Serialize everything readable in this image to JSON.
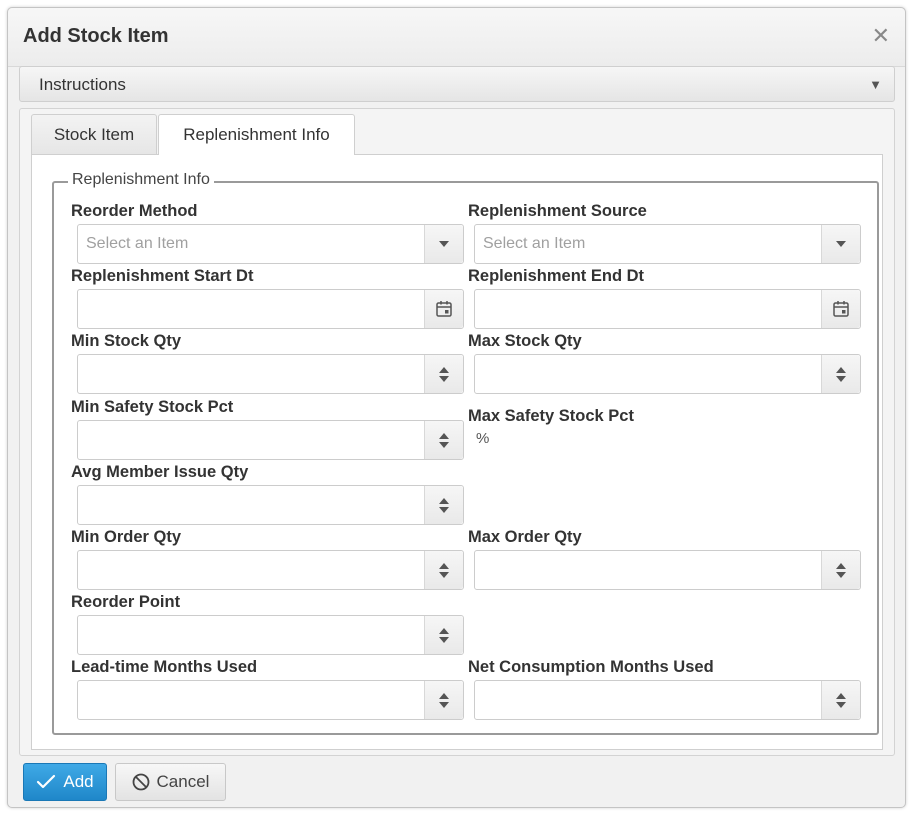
{
  "dialog": {
    "title": "Add Stock Item",
    "close_icon": "close-icon"
  },
  "instructions": {
    "label": "Instructions"
  },
  "tabs": [
    {
      "label": "Stock Item",
      "active": false
    },
    {
      "label": "Replenishment Info",
      "active": true
    }
  ],
  "section": {
    "legend": "Replenishment Info"
  },
  "fields": {
    "reorder_method": {
      "label": "Reorder Method",
      "placeholder": "Select an Item"
    },
    "replenishment_source": {
      "label": "Replenishment Source",
      "placeholder": "Select an Item"
    },
    "replenishment_start_dt": {
      "label": "Replenishment Start Dt"
    },
    "replenishment_end_dt": {
      "label": "Replenishment End Dt"
    },
    "min_stock_qty": {
      "label": "Min Stock Qty"
    },
    "max_stock_qty": {
      "label": "Max Stock Qty"
    },
    "min_safety_stock_pct": {
      "label": "Min Safety Stock Pct"
    },
    "max_safety_stock_pct": {
      "label": "Max Safety Stock Pct",
      "value": "%"
    },
    "avg_member_issue_qty": {
      "label": "Avg Member Issue Qty"
    },
    "min_order_qty": {
      "label": "Min Order Qty"
    },
    "max_order_qty": {
      "label": "Max Order Qty"
    },
    "reorder_point": {
      "label": "Reorder Point"
    },
    "lead_time_months_used": {
      "label": "Lead-time Months Used"
    },
    "net_consumption_months_used": {
      "label": "Net Consumption Months Used"
    }
  },
  "footer": {
    "add_label": "Add",
    "cancel_label": "Cancel"
  },
  "colors": {
    "primary": "#1f87c9",
    "border": "#cccccc"
  }
}
